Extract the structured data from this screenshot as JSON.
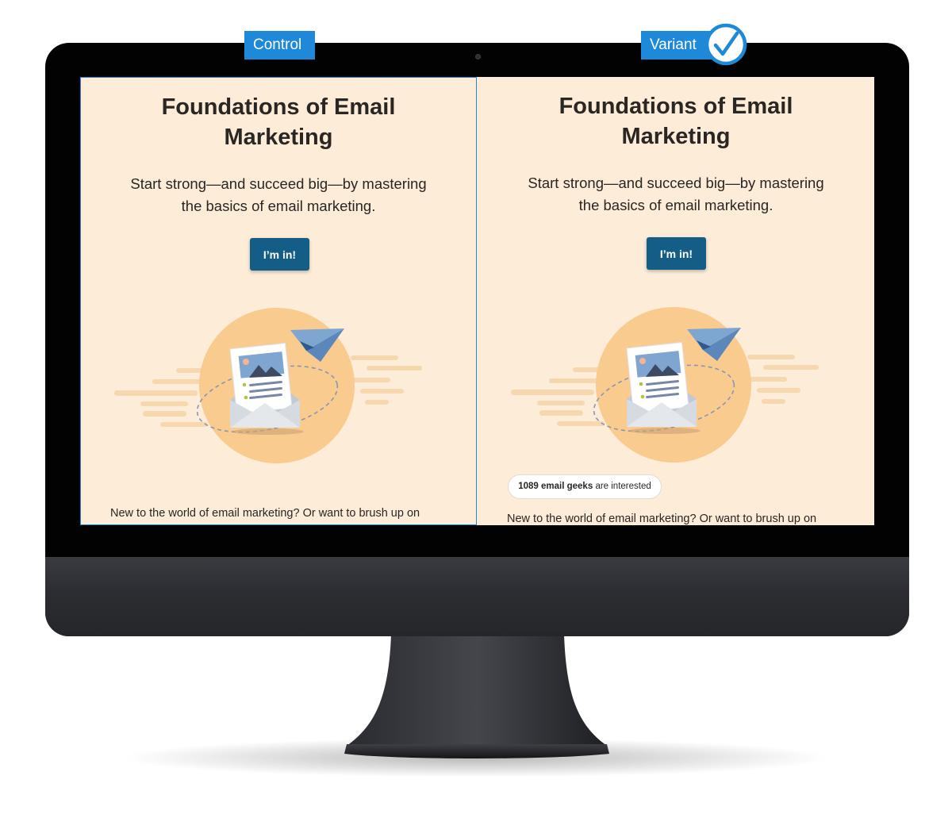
{
  "labels": {
    "control": "Control",
    "variant": "Variant"
  },
  "page": {
    "headline_line1": "Foundations of Email",
    "headline_line2": "Marketing",
    "subline_line1": "Start strong—and succeed big—by mastering",
    "subline_line2": "the basics of email marketing.",
    "cta_label": "I’m in!",
    "body_text": "New to the world of email marketing? Or want to brush up on"
  },
  "social_proof": {
    "count_text": "1089 email geeks",
    "suffix": "are interested"
  },
  "colors": {
    "label_blue": "#1e88d9",
    "cta_blue": "#135d86",
    "page_background": "#fcecd8",
    "illustration_circle": "#f9cb8e",
    "text": "#2a2623"
  },
  "icons": {
    "selected_marker": "checkmark-circle-icon",
    "illustration": "email-newsletter-paper-plane-illustration"
  }
}
